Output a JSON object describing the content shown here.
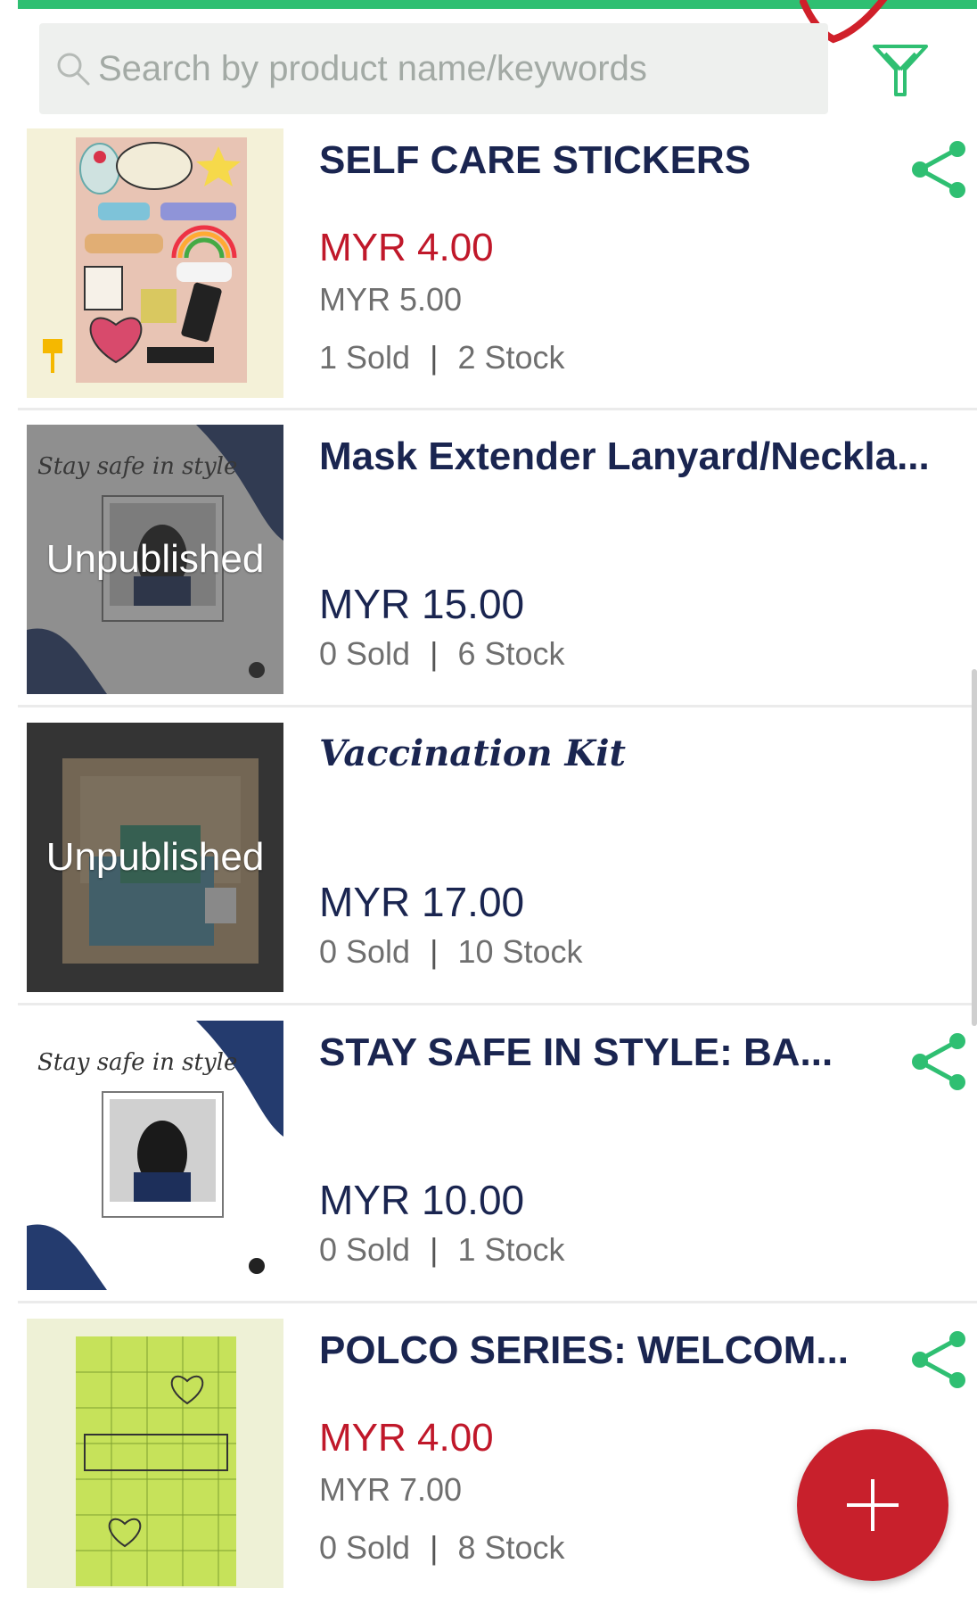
{
  "search": {
    "placeholder": "Search by product name/keywords"
  },
  "colors": {
    "accent_green": "#2fbf72",
    "price_sale": "#c0182a",
    "title": "#1a2550",
    "fab": "#c8202c"
  },
  "icons": {
    "search": "search-icon",
    "filter": "filter-icon",
    "share": "share-icon",
    "add": "plus-icon"
  },
  "products": [
    {
      "title": "SELF CARE STICKERS",
      "sale_price": "MYR 4.00",
      "original_price": "MYR 5.00",
      "sold": "1 Sold",
      "stock": "2 Stock",
      "separator": "|",
      "status": "",
      "shareable": true
    },
    {
      "title": "Mask Extender Lanyard/Neckla...",
      "price": "MYR 15.00",
      "sold": "0 Sold",
      "stock": "6 Stock",
      "separator": "|",
      "status": "Unpublished",
      "shareable": false
    },
    {
      "title": "Vaccination Kit",
      "price": "MYR 17.00",
      "sold": "0 Sold",
      "stock": "10 Stock",
      "separator": "|",
      "status": "Unpublished",
      "shareable": false
    },
    {
      "title": "STAY SAFE IN STYLE: BA...",
      "price": "MYR 10.00",
      "sold": "0 Sold",
      "stock": "1 Stock",
      "separator": "|",
      "status": "",
      "shareable": true
    },
    {
      "title": "POLCO SERIES: WELCOM...",
      "sale_price": "MYR 4.00",
      "original_price": "MYR 7.00",
      "sold": "0 Sold",
      "stock": "8 Stock",
      "separator": "|",
      "status": "",
      "shareable": true
    }
  ]
}
